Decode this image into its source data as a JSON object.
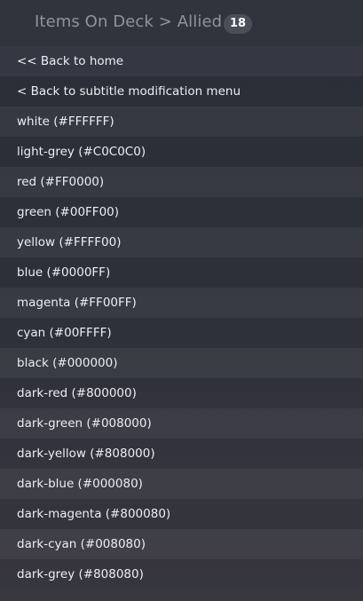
{
  "header": {
    "title": "Items On Deck > Allied",
    "count": "18"
  },
  "menu": {
    "items": [
      "<< Back to home",
      "< Back to subtitle modification menu",
      "white (#FFFFFF)",
      "light-grey (#C0C0C0)",
      "red (#FF0000)",
      "green (#00FF00)",
      "yellow (#FFFF00)",
      "blue (#0000FF)",
      "magenta (#FF00FF)",
      "cyan (#00FFFF)",
      "black (#000000)",
      "dark-red (#800000)",
      "dark-green (#008000)",
      "dark-yellow (#808000)",
      "dark-blue (#000080)",
      "dark-magenta (#800080)",
      "dark-cyan (#008080)",
      "dark-grey (#808080)"
    ]
  }
}
